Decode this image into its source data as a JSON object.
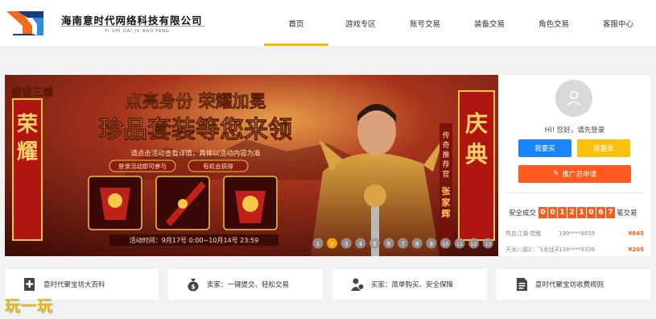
{
  "brand": {
    "title": "海南意时代网络科技有限公司",
    "subtitle": "YI SHI DAI JU BAO FANG"
  },
  "nav": {
    "items": [
      {
        "label": "首页",
        "active": true
      },
      {
        "label": "游戏专区",
        "active": false
      },
      {
        "label": "账号交易",
        "active": false
      },
      {
        "label": "装备交易",
        "active": false
      },
      {
        "label": "角色交易",
        "active": false
      },
      {
        "label": "客服中心",
        "active": false
      }
    ]
  },
  "banner": {
    "game_logo": "盛世三城",
    "headline": "点亮身份 荣耀加冕",
    "main": "珍品套装等您来领",
    "tip": "请点击活动查看详情，具体以活动内容为准",
    "tag1": "登录活动即可参与",
    "tag2": "有机会获得",
    "time": "活动时间：9月17号 0:00~10月14号 23:59",
    "left_banner": "荣耀",
    "right_banner": "庆典",
    "endorser_line": "传奇推荐官",
    "endorser_name": "张家辉",
    "pages": [
      "1",
      "2",
      "3",
      "4",
      "5",
      "6",
      "7",
      "8",
      "9",
      "10",
      "11",
      "12",
      "13"
    ],
    "active_page": 2
  },
  "user": {
    "greeting": "HI! 您好，请先登录",
    "buy": "我要买",
    "sell": "我要卖",
    "promo": "推广员申请"
  },
  "stats": {
    "prefix": "安全成交",
    "digits": [
      "0",
      "0",
      "1",
      "2",
      "1",
      "0",
      "6",
      "7"
    ],
    "suffix": "笔交易"
  },
  "deals": [
    {
      "game": "热血江湖·觉醒",
      "user": "199****8658",
      "price": "¥845"
    },
    {
      "game": "天龙八部2：飞龙战天",
      "user": "138****9336",
      "price": "¥205"
    }
  ],
  "quick_links": [
    {
      "label": "意时代聚宝坊大百科",
      "icon": "plus-doc-icon"
    },
    {
      "label": "卖家：一键提交、轻松交易",
      "icon": "money-bag-icon"
    },
    {
      "label": "买家：简单购买、安全保障",
      "icon": "buyer-icon"
    },
    {
      "label": "意时代聚宝坊收费规则",
      "icon": "rules-doc-icon"
    }
  ],
  "watermark": "玩一玩",
  "colors": {
    "accent": "#f6b60a",
    "blue": "#1a84ff",
    "yellow": "#f9c20a",
    "orange": "#ff5a1f"
  }
}
